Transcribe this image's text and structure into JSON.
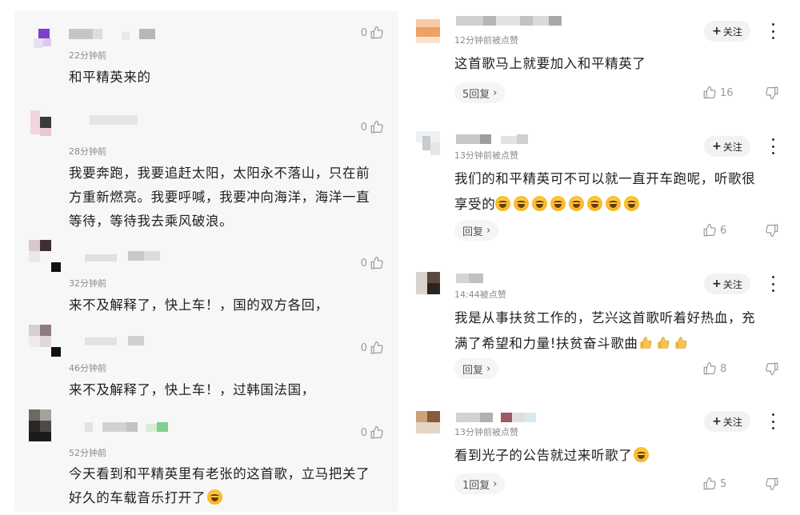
{
  "left_comments": [
    {
      "time": "22分钟前",
      "likes": "0",
      "lines": [
        "和平精英来的"
      ]
    },
    {
      "time": "28分钟前",
      "likes": "0",
      "lines": [
        "我要奔跑，我要追赶太阳，太阳永不落山，只在前",
        "方重新燃亮。我要呼喊，我要冲向海洋，海洋一直",
        "等待，等待我去乘风破浪。"
      ]
    },
    {
      "time": "32分钟前",
      "likes": "0",
      "lines": [
        "来不及解释了，快上车！，国的双方各回，"
      ]
    },
    {
      "time": "46分钟前",
      "likes": "0",
      "lines": [
        "来不及解释了，快上车！，过韩国法国，"
      ]
    },
    {
      "time": "52分钟前",
      "likes": "0",
      "lines": [
        "今天看到和平精英里有老张的这首歌，立马把关了",
        "好久的车载音乐打开了"
      ]
    }
  ],
  "right_comments": [
    {
      "time": "12分钟前被点赞",
      "follow": "关注",
      "lines": [
        "这首歌马上就要加入和平精英了"
      ],
      "reply": "5回复",
      "likes": "16"
    },
    {
      "time": "13分钟前被点赞",
      "follow": "关注",
      "lines": [
        "我们的和平精英可不可以就一直开车跑呢，听歌很",
        "享受的"
      ],
      "reply": "回复",
      "likes": "6"
    },
    {
      "time": "14:44被点赞",
      "follow": "关注",
      "lines": [
        "我是从事扶贫工作的，艺兴这首歌听着好热血，充",
        "满了希望和力量!扶贫奋斗歌曲"
      ],
      "reply": "回复",
      "likes": "8"
    },
    {
      "time": "13分钟前被点赞",
      "follow": "关注",
      "lines": [
        "看到光子的公告就过来听歌了"
      ],
      "reply": "1回复",
      "likes": "5"
    }
  ],
  "icons": {
    "like": "thumbs-up-outline-icon",
    "dislike": "thumbs-down-outline-icon",
    "more": "vertical-ellipsis-icon",
    "reply_arrow": "chevron-right-icon",
    "emoji_grin": "grinning-face-emoji",
    "emoji_thumb": "thumbs-up-emoji"
  },
  "colors": {
    "left_bg": "#f7f7f7",
    "muted": "#8a8a8a",
    "follow_bg": "#f2f2f2"
  }
}
